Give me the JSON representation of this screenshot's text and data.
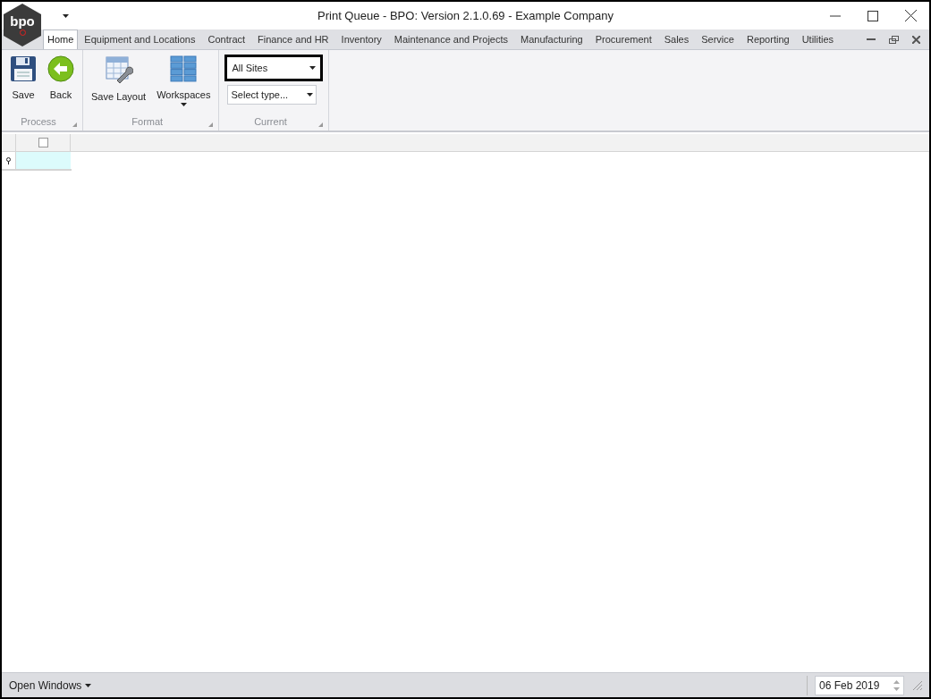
{
  "window": {
    "title": "Print Queue - BPO: Version 2.1.0.69 - Example Company"
  },
  "logo": {
    "text": "bpo"
  },
  "tabs": [
    {
      "label": "Home",
      "selected": true
    },
    {
      "label": "Equipment and Locations",
      "selected": false
    },
    {
      "label": "Contract",
      "selected": false
    },
    {
      "label": "Finance and HR",
      "selected": false
    },
    {
      "label": "Inventory",
      "selected": false
    },
    {
      "label": "Maintenance and Projects",
      "selected": false
    },
    {
      "label": "Manufacturing",
      "selected": false
    },
    {
      "label": "Procurement",
      "selected": false
    },
    {
      "label": "Sales",
      "selected": false
    },
    {
      "label": "Service",
      "selected": false
    },
    {
      "label": "Reporting",
      "selected": false
    },
    {
      "label": "Utilities",
      "selected": false
    }
  ],
  "ribbon_groups": [
    {
      "label": "Process",
      "items": [
        {
          "kind": "save",
          "label": "Save"
        },
        {
          "kind": "back",
          "label": "Back"
        }
      ]
    },
    {
      "label": "Format",
      "items": [
        {
          "kind": "layout",
          "label": "Save Layout"
        },
        {
          "kind": "workspaces",
          "label": "Workspaces"
        }
      ]
    },
    {
      "label": "Current",
      "items": [
        {
          "kind": "combo",
          "value": "All Sites",
          "focused": true
        },
        {
          "kind": "combo",
          "value": "Select type...",
          "focused": false
        }
      ]
    }
  ],
  "grid": {
    "header_checked": false
  },
  "status_bar": {
    "menu": "Open Windows",
    "date": "06 Feb 2019"
  }
}
